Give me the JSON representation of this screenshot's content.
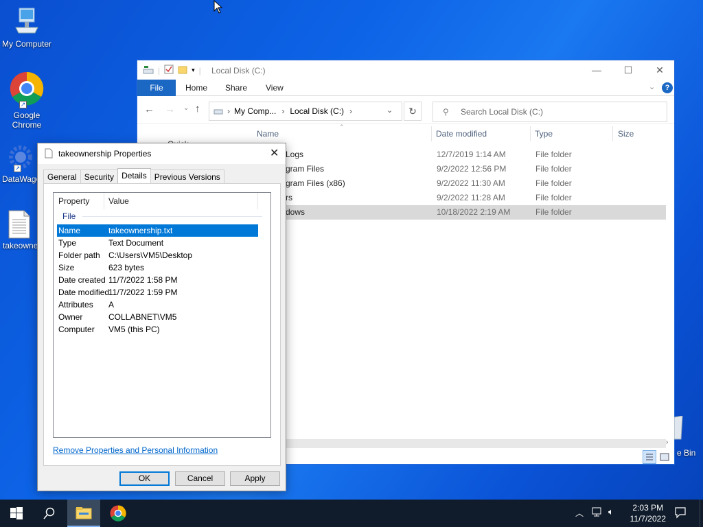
{
  "desktop": {
    "icons": [
      {
        "label": "My Computer",
        "icon": "computer-icon"
      },
      {
        "label": "Google Chrome",
        "icon": "chrome-icon"
      },
      {
        "label": "DataWago",
        "icon": "datawago-icon"
      },
      {
        "label": "takeowne",
        "icon": "text-file-icon"
      }
    ],
    "recycle_label": "e Bin"
  },
  "explorer": {
    "title": "Local Disk (C:)",
    "ribbon_tabs": [
      "File",
      "Home",
      "Share",
      "View"
    ],
    "breadcrumb": [
      "My Comp...",
      "Local Disk (C:)"
    ],
    "search_placeholder": "Search Local Disk (C:)",
    "columns": [
      "Name",
      "Date modified",
      "Type",
      "Size"
    ],
    "partial_row_text": "Quick",
    "rows": [
      {
        "name": "Logs",
        "date": "12/7/2019 1:14 AM",
        "type": "File folder"
      },
      {
        "name": "gram Files",
        "date": "9/2/2022 12:56 PM",
        "type": "File folder"
      },
      {
        "name": "gram Files (x86)",
        "date": "9/2/2022 11:30 AM",
        "type": "File folder"
      },
      {
        "name": "rs",
        "date": "9/2/2022 11:28 AM",
        "type": "File folder"
      },
      {
        "name": "dows",
        "date": "10/18/2022 2:19 AM",
        "type": "File folder",
        "selected": true
      }
    ]
  },
  "dialog": {
    "title": "takeownership Properties",
    "tabs": [
      "General",
      "Security",
      "Details",
      "Previous Versions"
    ],
    "active_tab": "Details",
    "headers": {
      "property": "Property",
      "value": "Value"
    },
    "group": "File",
    "properties": [
      {
        "property": "Name",
        "value": "takeownership.txt",
        "selected": true
      },
      {
        "property": "Type",
        "value": "Text Document"
      },
      {
        "property": "Folder path",
        "value": "C:\\Users\\VM5\\Desktop"
      },
      {
        "property": "Size",
        "value": "623 bytes"
      },
      {
        "property": "Date created",
        "value": "11/7/2022 1:58 PM"
      },
      {
        "property": "Date modified",
        "value": "11/7/2022 1:59 PM"
      },
      {
        "property": "Attributes",
        "value": "A"
      },
      {
        "property": "Owner",
        "value": "COLLABNET\\VM5"
      },
      {
        "property": "Computer",
        "value": "VM5 (this PC)"
      }
    ],
    "remove_link": "Remove Properties and Personal Information",
    "buttons": {
      "ok": "OK",
      "cancel": "Cancel",
      "apply": "Apply"
    }
  },
  "taskbar": {
    "time": "2:03 PM",
    "date": "11/7/2022"
  },
  "colors": {
    "accent": "#0078d7",
    "ribbon_file": "#1a67c4",
    "taskbar": "#101c2c",
    "link": "#0066cc"
  }
}
